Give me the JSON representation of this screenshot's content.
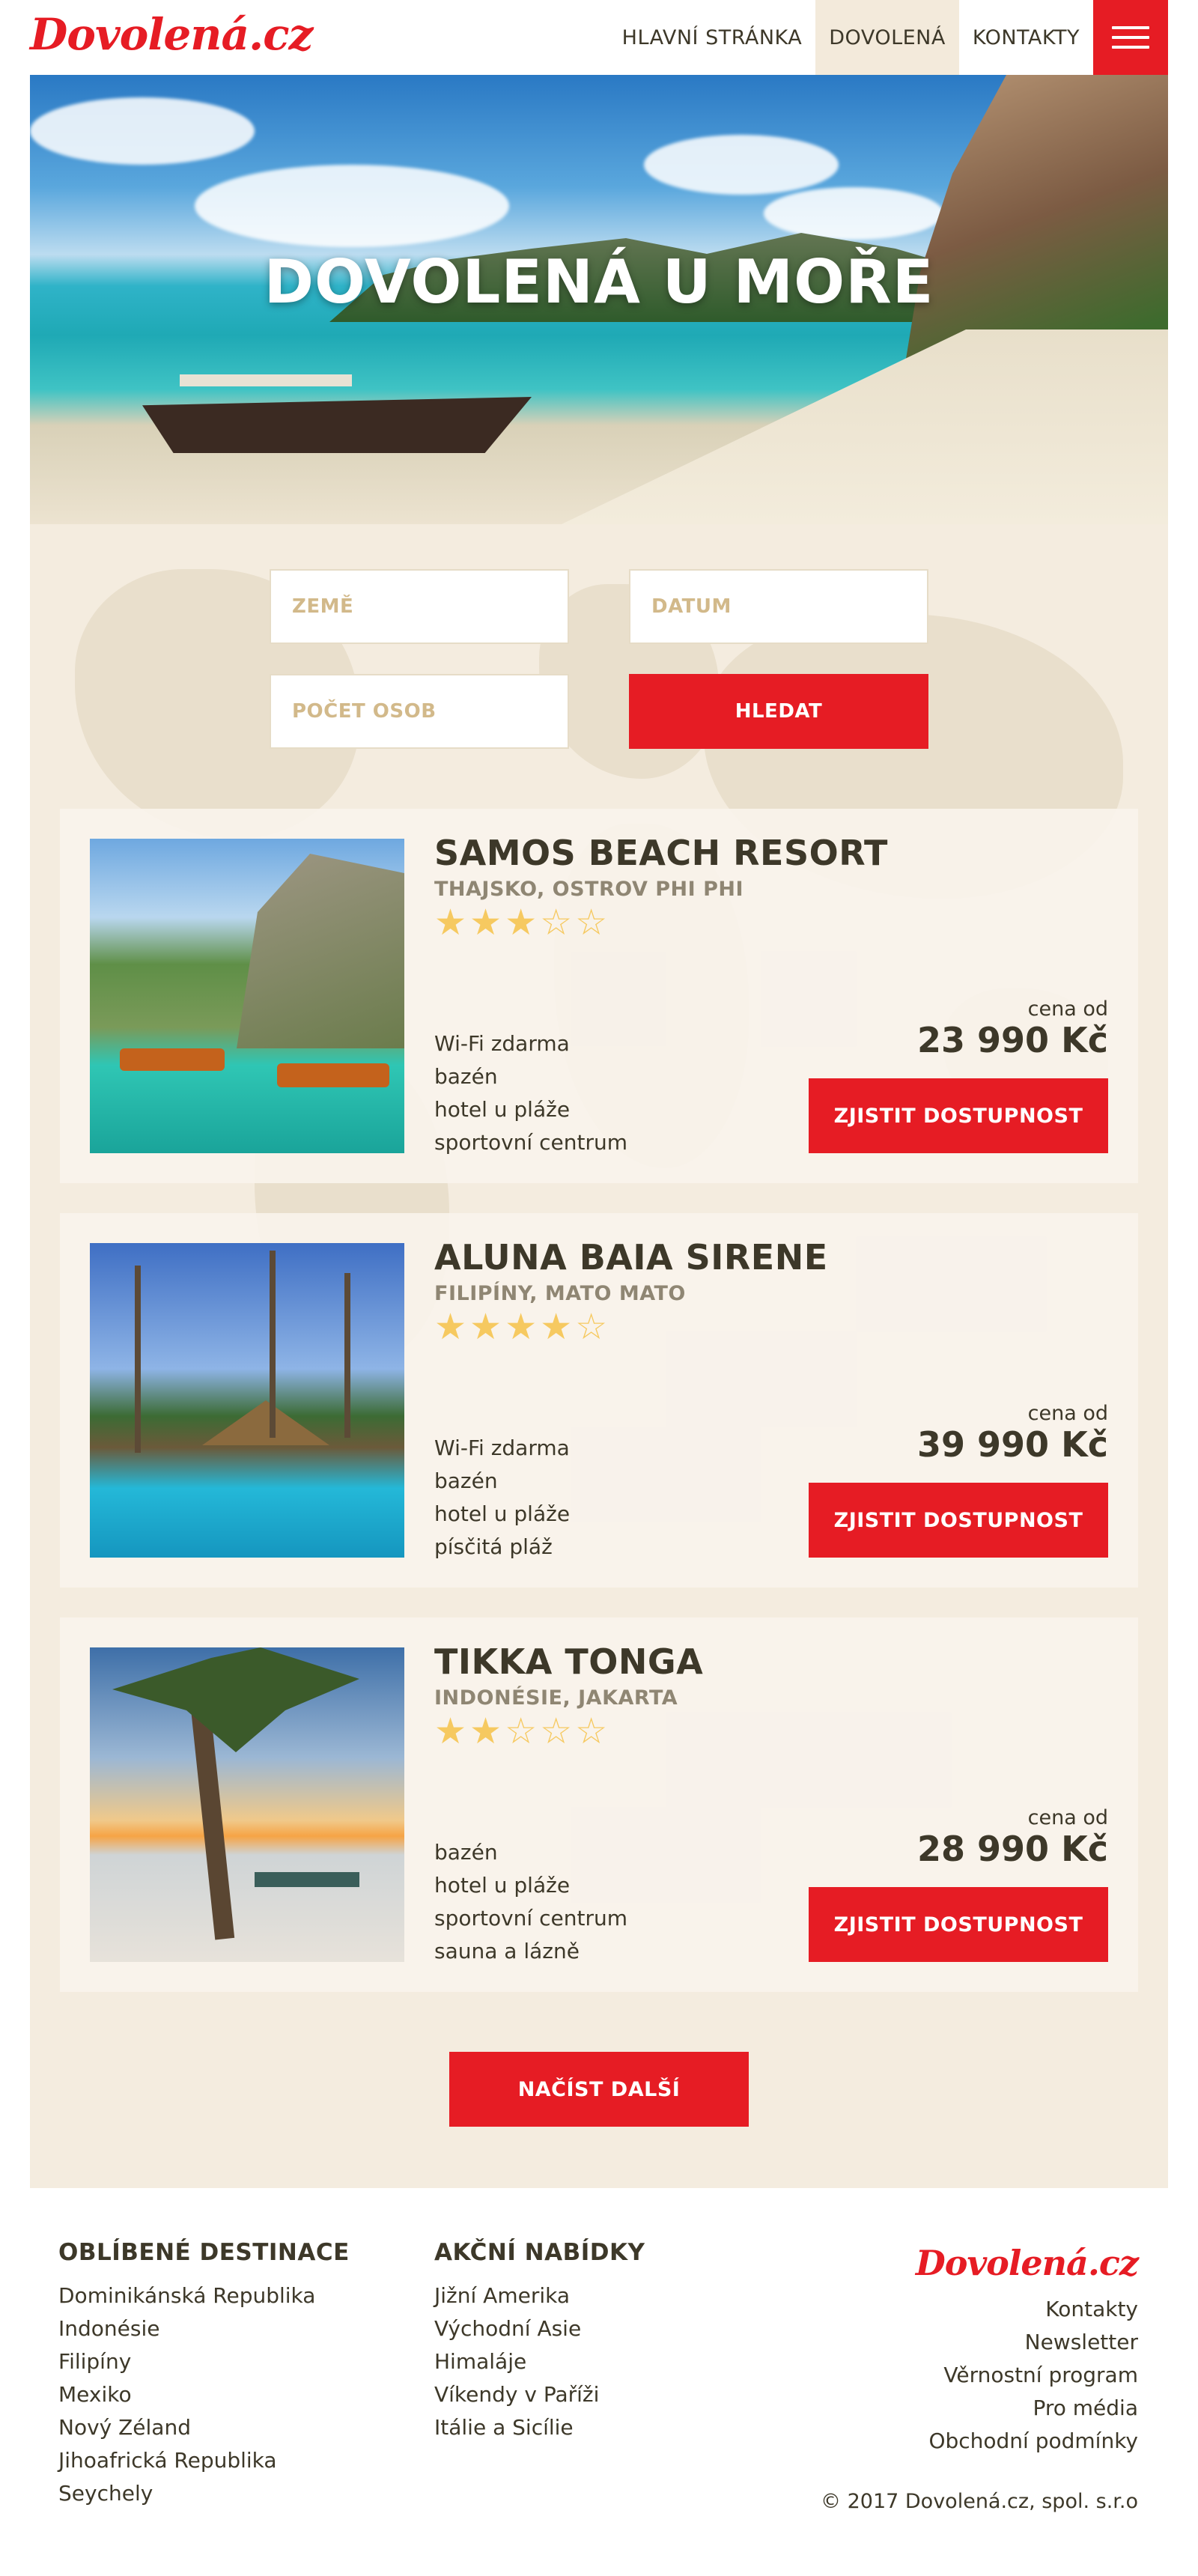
{
  "header": {
    "logo": "Dovolená.cz",
    "nav": [
      {
        "label": "HLAVNÍ STRÁNKA",
        "active": false
      },
      {
        "label": "DOVOLENÁ",
        "active": true
      },
      {
        "label": "KONTAKTY",
        "active": false
      }
    ]
  },
  "hero": {
    "title": "DOVOLENÁ U MOŘE"
  },
  "search": {
    "country_placeholder": "ZEMĚ",
    "date_placeholder": "DATUM",
    "persons_placeholder": "POČET OSOB",
    "submit_label": "HLEDAT"
  },
  "hotels": [
    {
      "name": "SAMOS BEACH RESORT",
      "location": "THAJSKO, OSTROV PHI PHI",
      "rating": 3,
      "rating_max": 5,
      "features": [
        "Wi-Fi zdarma",
        "bazén",
        "hotel u pláže",
        "sportovní centrum"
      ],
      "price_label": "cena od",
      "price": "23 990 Kč",
      "button": "ZJISTIT DOSTUPNOST"
    },
    {
      "name": "ALUNA BAIA SIRENE",
      "location": "FILIPÍNY, MATO MATO",
      "rating": 4,
      "rating_max": 5,
      "features": [
        "Wi-Fi zdarma",
        "bazén",
        "hotel u pláže",
        "písčitá pláž"
      ],
      "price_label": "cena od",
      "price": "39 990 Kč",
      "button": "ZJISTIT DOSTUPNOST"
    },
    {
      "name": "TIKKA TONGA",
      "location": "INDONÉSIE, JAKARTA",
      "rating": 2,
      "rating_max": 5,
      "features": [
        "bazén",
        "hotel u pláže",
        "sportovní centrum",
        "sauna a lázně"
      ],
      "price_label": "cena od",
      "price": "28 990 Kč",
      "button": "ZJISTIT DOSTUPNOST"
    }
  ],
  "load_more": "NAČÍST DALŠÍ",
  "footer": {
    "destinations": {
      "heading": "OBLÍBENÉ DESTINACE",
      "links": [
        "Dominikánská Republika",
        "Indonésie",
        "Filipíny",
        "Mexiko",
        "Nový Zéland",
        "Jihoafrická Republika",
        "Seychely"
      ]
    },
    "offers": {
      "heading": "AKČNÍ NABÍDKY",
      "links": [
        "Jižní Amerika",
        "Východní Asie",
        "Himaláje",
        "Víkendy v Paříži",
        "Itálie a Sicílie"
      ]
    },
    "logo": "Dovolená.cz",
    "info_links": [
      "Kontakty",
      "Newsletter",
      "Věrnostní program",
      "Pro média",
      "Obchodní podmínky"
    ],
    "copyright": "© 2017 Dovolená.cz, spol. s.r.o"
  },
  "colors": {
    "brand_red": "#e61c24",
    "beige_bg": "#f4ecdf",
    "text_dark": "#3d3829",
    "star": "#f6c960"
  }
}
